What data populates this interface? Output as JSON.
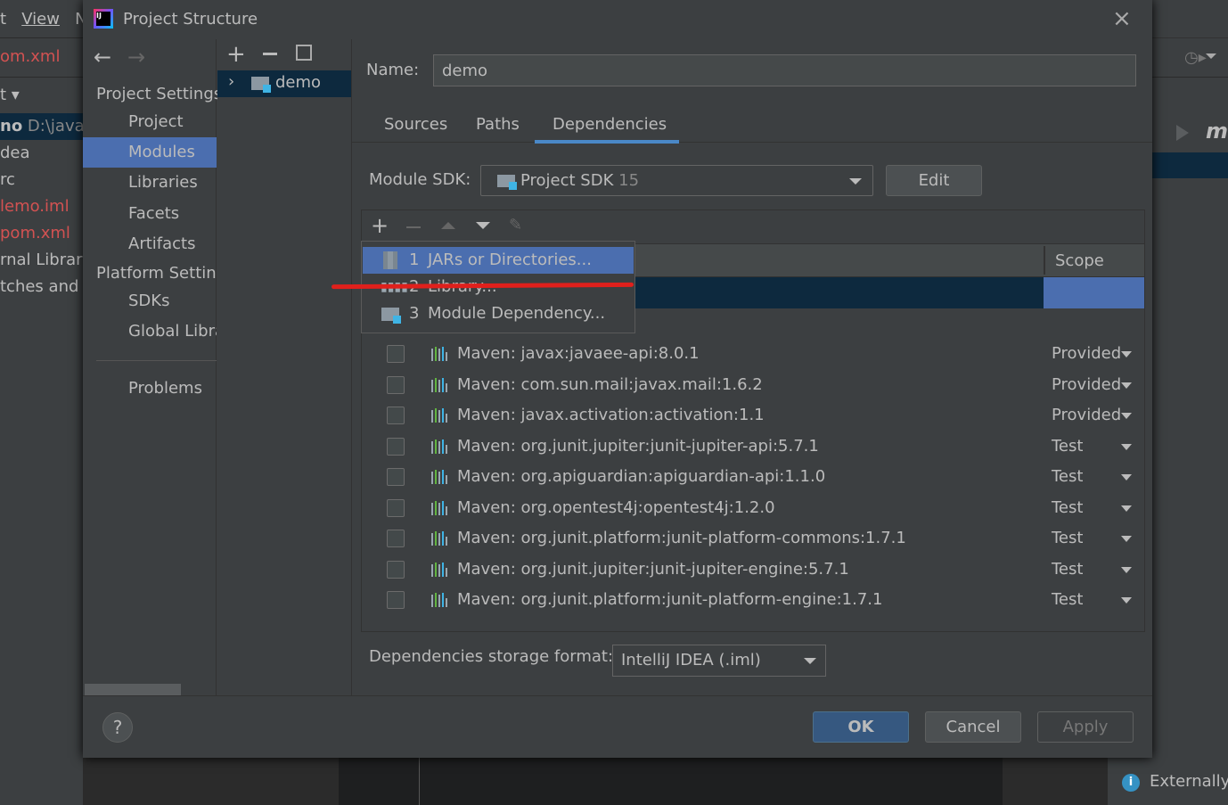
{
  "background_ide": {
    "menu": [
      "t",
      "View",
      "N"
    ],
    "tab_file": "om.xml",
    "project_dropdown": "t",
    "tree": [
      {
        "label": "no",
        "extra": "D:\\java\\",
        "color": "#bbbbbb"
      },
      {
        "label": "dea",
        "color": "#bbbbbb"
      },
      {
        "label": "rc",
        "color": "#bbbbbb"
      },
      {
        "label": "lemo.iml",
        "color": "#d25252"
      },
      {
        "label": "pom.xml",
        "color": "#d25252"
      },
      {
        "label": "rnal Librari",
        "color": "#bbbbbb"
      },
      {
        "label": "tches and C",
        "color": "#bbbbbb"
      }
    ],
    "right_label": "m",
    "notification": "Externally"
  },
  "dialog": {
    "title": "Project Structure",
    "nav": {
      "project_settings_header": "Project Settings",
      "project_items": [
        "Project",
        "Modules",
        "Libraries",
        "Facets",
        "Artifacts"
      ],
      "selected": "Modules",
      "platform_settings_header": "Platform Settings",
      "platform_items": [
        "SDKs",
        "Global Libraries"
      ],
      "problems": "Problems"
    },
    "tree": {
      "module": "demo"
    },
    "name_label": "Name:",
    "name_value": "demo",
    "tabs": [
      "Sources",
      "Paths",
      "Dependencies"
    ],
    "active_tab": "Dependencies",
    "module_sdk_label": "Module SDK:",
    "module_sdk_value": "Project SDK",
    "module_sdk_version": "15",
    "edit_label": "Edit",
    "table_header_scope": "Scope",
    "popup": [
      {
        "num": "1",
        "label": "JARs or Directories..."
      },
      {
        "num": "2",
        "label": "Library..."
      },
      {
        "num": "3",
        "label": "Module Dependency..."
      }
    ],
    "dependencies": [
      {
        "name": "Maven: javax:javaee-api:8.0.1",
        "scope": "Provided"
      },
      {
        "name": "Maven: com.sun.mail:javax.mail:1.6.2",
        "scope": "Provided"
      },
      {
        "name": "Maven: javax.activation:activation:1.1",
        "scope": "Provided"
      },
      {
        "name": "Maven: org.junit.jupiter:junit-jupiter-api:5.7.1",
        "scope": "Test"
      },
      {
        "name": "Maven: org.apiguardian:apiguardian-api:1.1.0",
        "scope": "Test"
      },
      {
        "name": "Maven: org.opentest4j:opentest4j:1.2.0",
        "scope": "Test"
      },
      {
        "name": "Maven: org.junit.platform:junit-platform-commons:1.7.1",
        "scope": "Test"
      },
      {
        "name": "Maven: org.junit.jupiter:junit-jupiter-engine:5.7.1",
        "scope": "Test"
      },
      {
        "name": "Maven: org.junit.platform:junit-platform-engine:1.7.1",
        "scope": "Test"
      }
    ],
    "storage_label": "Dependencies storage format:",
    "storage_value": "IntelliJ IDEA (.iml)",
    "ok": "OK",
    "cancel": "Cancel",
    "apply": "Apply",
    "help": "?"
  },
  "colors": {
    "selection": "#4b6eaf",
    "dark_selection": "#0d293e",
    "annotation": "#e0201c"
  }
}
